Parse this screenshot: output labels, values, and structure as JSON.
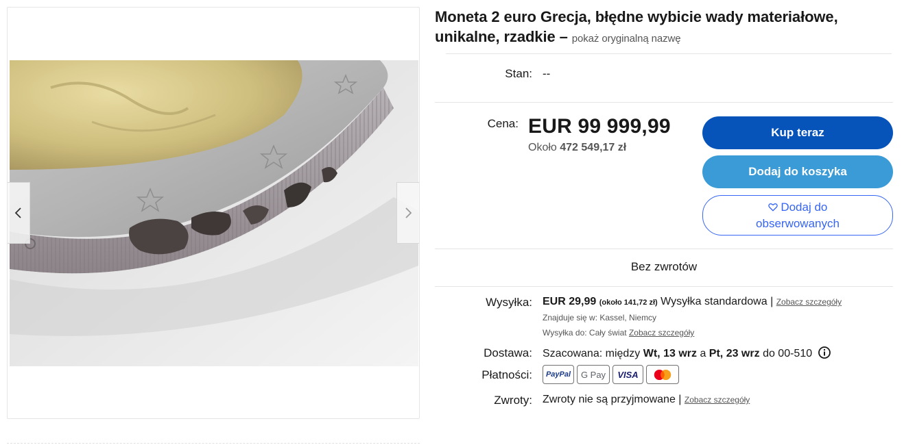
{
  "gallery": {
    "image_alt": "Moneta 2 euro – zbliżenie krawędzi z wadami materiałowymi",
    "prev_icon": "chevron-left-icon",
    "next_icon": "chevron-right-icon"
  },
  "listing": {
    "title": "Moneta 2 euro Grecja, błędne wybicie wady materiałowe, unikalne, rzadkie",
    "title_separator": "–",
    "show_original": "pokaż oryginalną nazwę",
    "condition_label": "Stan:",
    "condition_value": "--",
    "price_label": "Cena:",
    "price": "EUR 99 999,99",
    "approx_prefix": "Około",
    "approx_value": "472 549,17 zł"
  },
  "buttons": {
    "buy_now": "Kup teraz",
    "add_to_cart": "Dodaj do koszyka",
    "watch": "Dodaj do obserwowanych",
    "watch_icon": "heart-icon"
  },
  "returns_banner": "Bez zwrotów",
  "shipping": {
    "label": "Wysyłka:",
    "price": "EUR 29,99",
    "approx": "(około 141,72 zł)",
    "service": "Wysyłka standardowa",
    "separator": "|",
    "details_link": "Zobacz szczegóły",
    "location": "Znajduje się w: Kassel, Niemcy",
    "ships_to": "Wysyłka do: Cały świat",
    "ships_to_link": "Zobacz szczegóły"
  },
  "delivery": {
    "label": "Dostawa:",
    "prefix": "Szacowana: między",
    "from": "Wt, 13 wrz",
    "and": "a",
    "to": "Pt, 23 wrz",
    "suffix": "do 00-510",
    "info_icon": "info-icon"
  },
  "payments": {
    "label": "Płatności:",
    "methods": [
      "PayPal",
      "G Pay",
      "VISA",
      "Mastercard"
    ]
  },
  "returns": {
    "label": "Zwroty:",
    "text": "Zwroty nie są przyjmowane",
    "separator": "|",
    "details_link": "Zobacz szczegóły"
  },
  "colors": {
    "buy_button": "#0654ba",
    "cart_button": "#3a9bd6",
    "watch_border": "#3665f3"
  }
}
